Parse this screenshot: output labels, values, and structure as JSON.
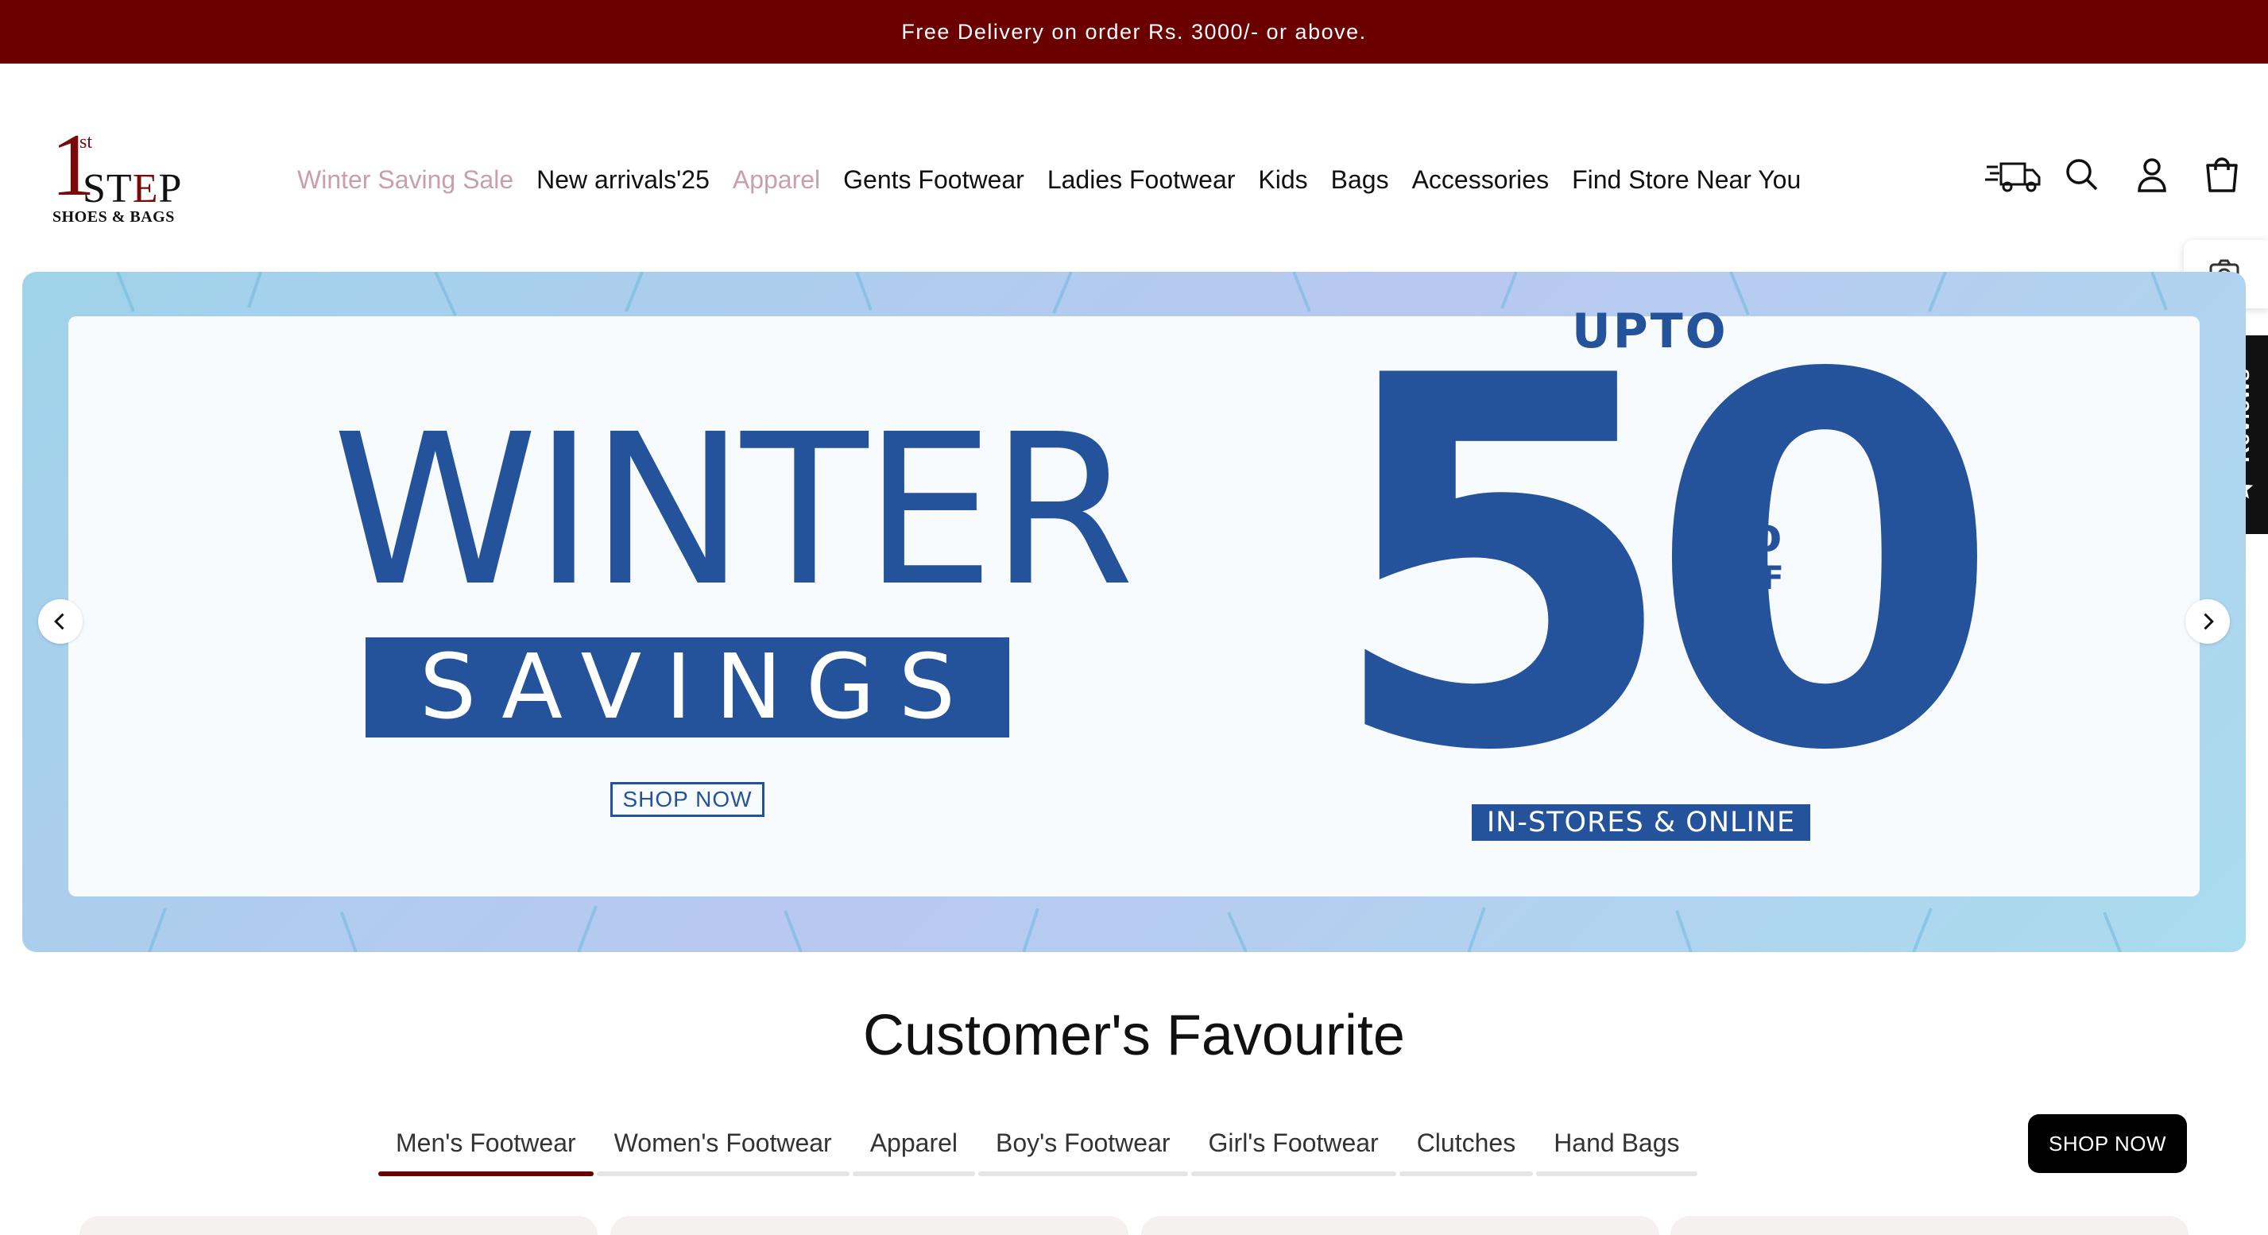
{
  "announcement": {
    "text": "Free Delivery on order Rs. 3000/- or above."
  },
  "logo": {
    "numeral": "1",
    "superscript": "st",
    "word_left": "ST",
    "word_mid": "E",
    "word_right": "P",
    "tagline": "SHOES & BAGS"
  },
  "nav": {
    "items": [
      {
        "label": "Winter Saving Sale"
      },
      {
        "label": "New arrivals'25"
      },
      {
        "label": "Apparel"
      },
      {
        "label": "Gents Footwear"
      },
      {
        "label": "Ladies Footwear"
      },
      {
        "label": "Kids"
      },
      {
        "label": "Bags"
      },
      {
        "label": "Accessories"
      },
      {
        "label": "Find Store Near You"
      }
    ]
  },
  "header_icons": [
    "delivery-truck-icon",
    "search-icon",
    "account-icon",
    "cart-icon"
  ],
  "side_tabs": {
    "reviews_label": "Reviews",
    "camera_icon": "camera-icon"
  },
  "banner": {
    "headline": "WINTER",
    "subhead": "SAVINGS",
    "cta": "SHOP NOW",
    "upto": "UPTO",
    "discount": "50",
    "percent": "%",
    "off": "OFF",
    "channel": "IN-STORES & ONLINE"
  },
  "favourites": {
    "title": "Customer's Favourite",
    "tabs": [
      {
        "label": "Men's Footwear",
        "active": true
      },
      {
        "label": "Women's Footwear"
      },
      {
        "label": "Apparel"
      },
      {
        "label": "Boy's Footwear"
      },
      {
        "label": "Girl's Footwear"
      },
      {
        "label": "Clutches"
      },
      {
        "label": "Hand Bags"
      }
    ],
    "shop_now": "SHOP NOW"
  },
  "colors": {
    "brand": "#6b0000",
    "banner_blue": "#24539b",
    "muted_nav": "#c9a0a8"
  }
}
